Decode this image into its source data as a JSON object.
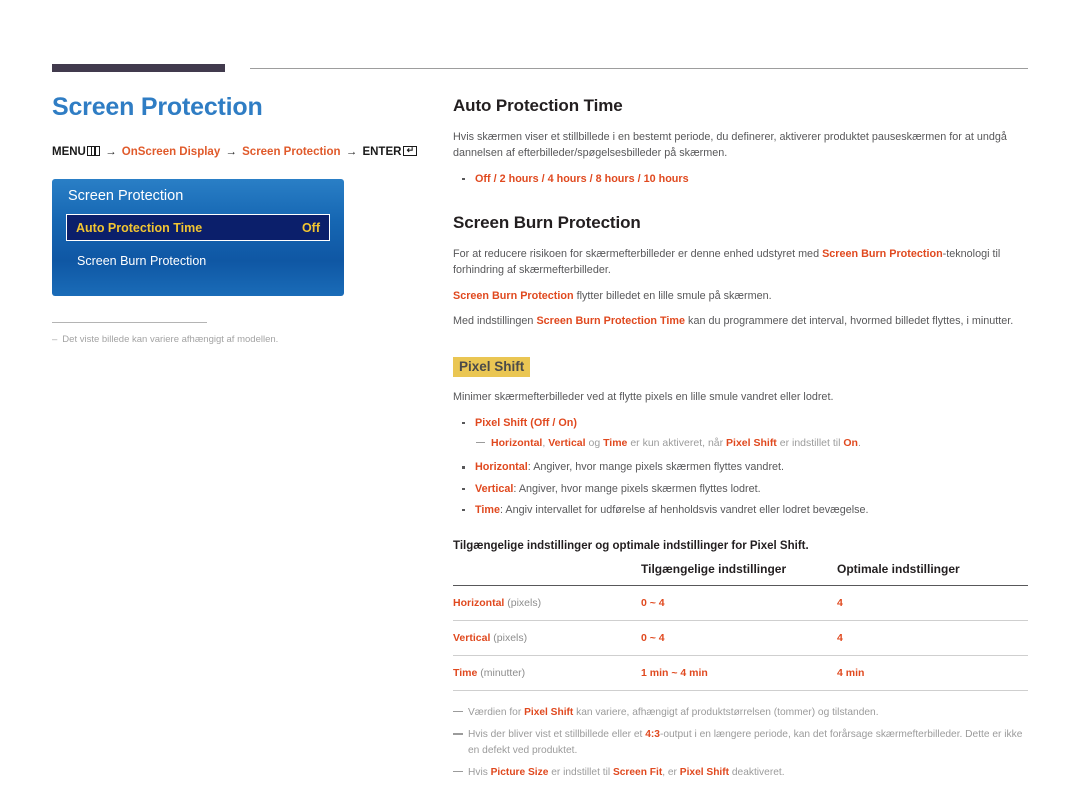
{
  "left": {
    "page_title": "Screen Protection",
    "breadcrumb": {
      "menu_label": "MENU",
      "menu_icon": "menu-bars-icon",
      "arrow": "→",
      "item1": "OnScreen Display",
      "item2": "Screen Protection",
      "enter_label": "ENTER",
      "enter_icon": "enter-return-icon",
      "enter_glyph": "↵"
    },
    "osd": {
      "title": "Screen Protection",
      "rows": [
        {
          "label": "Auto Protection Time",
          "value": "Off",
          "selected": true
        },
        {
          "label": "Screen Burn Protection",
          "value": "",
          "selected": false
        }
      ]
    },
    "note": {
      "dash": "–",
      "text": "Det viste billede kan variere afhængigt af modellen."
    }
  },
  "right": {
    "auto_protection": {
      "heading": "Auto Protection Time",
      "paragraph": "Hvis skærmen viser et stillbillede i en bestemt periode, du definerer, aktiverer produktet pauseskærmen for at undgå dannelsen af efterbilleder/spøgelsesbilleder på skærmen.",
      "options": {
        "off": "Off",
        "sep": " / ",
        "h2": "2 hours",
        "h4": "4 hours",
        "h8": "8 hours",
        "h10": "10 hours"
      }
    },
    "burn_protection": {
      "heading": "Screen Burn Protection",
      "p1_a": "For at reducere risikoen for skærmefterbilleder er denne enhed udstyret med ",
      "p1_b": "Screen Burn Protection",
      "p1_c": "-teknologi til forhindring af skærmefterbilleder.",
      "p2_a": "Screen Burn Protection",
      "p2_b": " flytter billedet en lille smule på skærmen.",
      "p3_a": "Med indstillingen ",
      "p3_b": "Screen Burn Protection Time",
      "p3_c": " kan du programmere det interval, hvormed billedet flyttes, i minutter."
    },
    "pixel_shift": {
      "pill": "Pixel Shift",
      "intro": "Minimer skærmefterbilleder ved at flytte pixels en lille smule vandret eller lodret.",
      "bullet_main": {
        "name": "Pixel Shift",
        "paren_open": " (",
        "off": "Off",
        "slash": " / ",
        "on": "On",
        "paren_close": ")"
      },
      "subnote": {
        "horizontal": "Horizontal",
        "comma": ", ",
        "vertical": "Vertical",
        "og": " og ",
        "time": "Time",
        "mid": " er kun aktiveret, når ",
        "pixel_shift": "Pixel Shift",
        "mid2": " er indstillet til ",
        "on": "On",
        "end": "."
      },
      "bullets": [
        {
          "label": "Horizontal",
          "text": ": Angiver, hvor mange pixels skærmen flyttes vandret."
        },
        {
          "label": "Vertical",
          "text": ": Angiver, hvor mange pixels skærmen flyttes lodret."
        },
        {
          "label": "Time",
          "text": ": Angiv intervallet for udførelse af henholdsvis vandret eller lodret bevægelse."
        }
      ],
      "table_caption": "Tilgængelige indstillinger og optimale indstillinger for Pixel Shift.",
      "table": {
        "headers": [
          "",
          "Tilgængelige indstillinger",
          "Optimale indstillinger"
        ],
        "rows": [
          {
            "label": "Horizontal",
            "unit": " (pixels)",
            "available": "0 ~ 4",
            "optimal": "4"
          },
          {
            "label": "Vertical",
            "unit": " (pixels)",
            "available": "0 ~ 4",
            "optimal": "4"
          },
          {
            "label": "Time",
            "unit": " (minutter)",
            "available": "1 min ~ 4 min",
            "optimal": "4 min"
          }
        ]
      },
      "footnotes": [
        {
          "a": "Værdien for ",
          "b": "Pixel Shift",
          "c": " kan variere, afhængigt af produktstørrelsen (tommer) og tilstanden.",
          "d": "",
          "e": "",
          "f": "",
          "g": ""
        },
        {
          "a": "Hvis der bliver vist et stillbillede eller et ",
          "b": "4:3",
          "c": "-output i en længere periode, kan det forårsage skærmefterbilleder. Dette er ikke en defekt ved produktet.",
          "d": "",
          "e": "",
          "f": "",
          "g": ""
        },
        {
          "a": "Hvis ",
          "b": "Picture Size",
          "c": " er indstillet til ",
          "d": "Screen Fit",
          "e": ", er ",
          "f": "Pixel Shift",
          "g": " deaktiveret."
        }
      ]
    }
  },
  "colors": {
    "accent_blue": "#2f7dc4",
    "accent_orange": "#e0491f",
    "highlight_yellow": "#eac653",
    "osd_selected_bg": "#0b1f6b",
    "osd_value_yellow": "#f2c531",
    "rule_dark": "#413a4d"
  }
}
